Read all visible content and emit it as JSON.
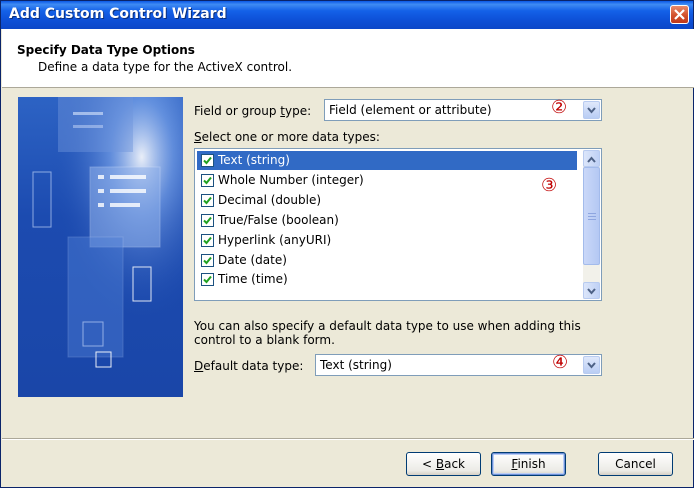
{
  "window": {
    "title": "Add Custom Control Wizard"
  },
  "header": {
    "title": "Specify Data Type Options",
    "subtitle": "Define a data type for the ActiveX control."
  },
  "field_type": {
    "label_pre": "Field or group ",
    "label_accel": "t",
    "label_post": "ype:",
    "value": "Field (element or attribute)",
    "marker": "②"
  },
  "data_types": {
    "label_accel": "S",
    "label_post": "elect one or more data types:",
    "marker": "③",
    "items": [
      {
        "label": "Text (string)",
        "checked": true,
        "selected": true
      },
      {
        "label": "Whole Number (integer)",
        "checked": true,
        "selected": false
      },
      {
        "label": "Decimal (double)",
        "checked": true,
        "selected": false
      },
      {
        "label": "True/False (boolean)",
        "checked": true,
        "selected": false
      },
      {
        "label": "Hyperlink (anyURI)",
        "checked": true,
        "selected": false
      },
      {
        "label": "Date (date)",
        "checked": true,
        "selected": false
      },
      {
        "label": "Time (time)",
        "checked": true,
        "selected": false
      }
    ]
  },
  "default_type": {
    "hint_line1": "You can also specify a default data type to use when adding this",
    "hint_line2": "control to a blank form.",
    "label_accel": "D",
    "label_post": "efault data type:",
    "value": "Text (string)",
    "marker": "④"
  },
  "buttons": {
    "back_pre": "< ",
    "back_accel": "B",
    "back_post": "ack",
    "finish_accel": "F",
    "finish_post": "inish",
    "cancel": "Cancel"
  },
  "colors": {
    "titlebar": "#0b4fd6",
    "selection": "#316ac5",
    "marker": "#c00000",
    "banner": "#1c4bb0"
  }
}
